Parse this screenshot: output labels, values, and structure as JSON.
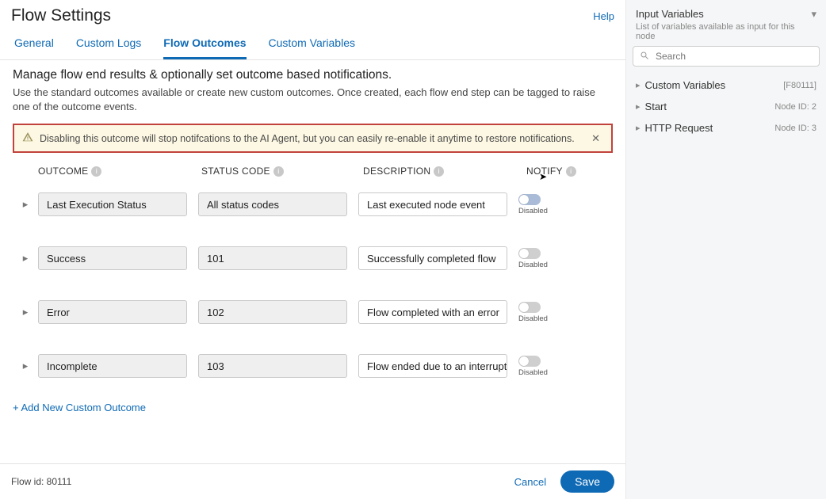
{
  "header": {
    "title": "Flow Settings",
    "help": "Help"
  },
  "tabs": {
    "items": [
      "General",
      "Custom Logs",
      "Flow Outcomes",
      "Custom Variables"
    ],
    "active": 2
  },
  "section": {
    "heading": "Manage flow end results & optionally set outcome based notifications.",
    "sub": "Use the standard outcomes available or create new custom outcomes. Once created, each flow end step can be tagged to raise one of the outcome events."
  },
  "alert": {
    "text": "Disabling this outcome will stop notifcations to the AI Agent, but you can easily re-enable it anytime to restore notifications."
  },
  "columns": {
    "c1": "OUTCOME",
    "c2": "STATUS CODE",
    "c3": "DESCRIPTION",
    "c4": "NOTIFY"
  },
  "notify_label": "Disabled",
  "rows": [
    {
      "outcome": "Last Execution Status",
      "code": "All status codes",
      "desc": "Last executed node event",
      "focused": true
    },
    {
      "outcome": "Success",
      "code": "101",
      "desc": "Successfully completed flow",
      "focused": false
    },
    {
      "outcome": "Error",
      "code": "102",
      "desc": "Flow completed with an error",
      "focused": false
    },
    {
      "outcome": "Incomplete",
      "code": "103",
      "desc": "Flow ended due to an interruption",
      "focused": false
    }
  ],
  "add_link": "+ Add New Custom Outcome",
  "footer": {
    "flow_id": "Flow id: 80111",
    "cancel": "Cancel",
    "save": "Save"
  },
  "side": {
    "title": "Input Variables",
    "sub": "List of variables available as input for this node",
    "search_placeholder": "Search",
    "items": [
      {
        "label": "Custom Variables",
        "meta": "[F80111]"
      },
      {
        "label": "Start",
        "meta": "Node ID: 2"
      },
      {
        "label": "HTTP Request",
        "meta": "Node ID: 3"
      }
    ]
  }
}
